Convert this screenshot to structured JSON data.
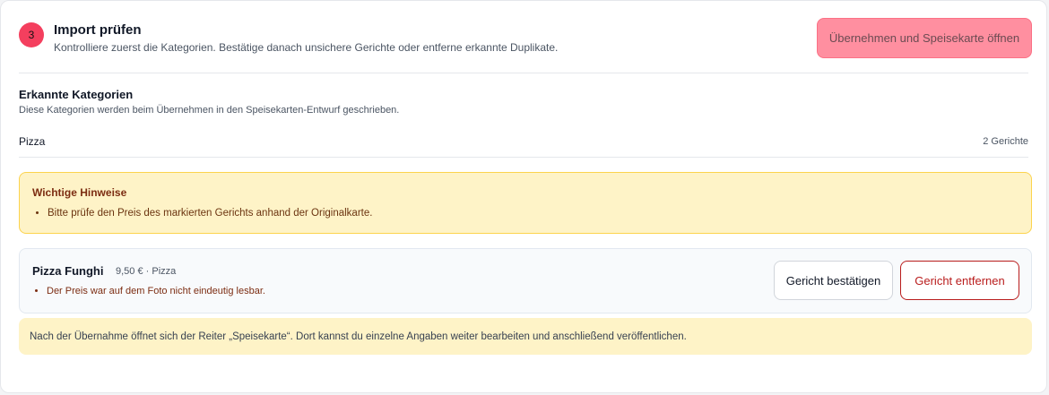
{
  "step": {
    "number": "3",
    "title": "Import prüfen",
    "description": "Kontrolliere zuerst die Kategorien. Bestätige danach unsichere Gerichte oder entferne erkannte Duplikate.",
    "apply_label": "Übernehmen und Speisekarte öffnen"
  },
  "categories": {
    "title": "Erkannte Kategorien",
    "description": "Diese Kategorien werden beim Übernehmen in den Speisekarten-Entwurf geschrieben.",
    "items": [
      {
        "name": "Pizza",
        "count": "2 Gerichte"
      }
    ]
  },
  "notice": {
    "title": "Wichtige Hinweise",
    "items": [
      "Bitte prüfe den Preis des markierten Gerichts anhand der Originalkarte."
    ]
  },
  "dish": {
    "name": "Pizza Funghi",
    "meta": "9,50 € · Pizza",
    "issues": [
      "Der Preis war auf dem Foto nicht eindeutig lesbar."
    ],
    "confirm_label": "Gericht bestätigen",
    "remove_label": "Gericht entfernen"
  },
  "footnote": "Nach der Übernahme öffnet sich der Reiter „Speisekarte“. Dort kannst du einzelne Angaben weiter bearbeiten und anschließend veröffentlichen.",
  "colors": {
    "accent": "#f43f5e",
    "apply_button_bg": "#ff8fa0",
    "warning_bg": "#fef3c7",
    "danger": "#b91c1c"
  }
}
